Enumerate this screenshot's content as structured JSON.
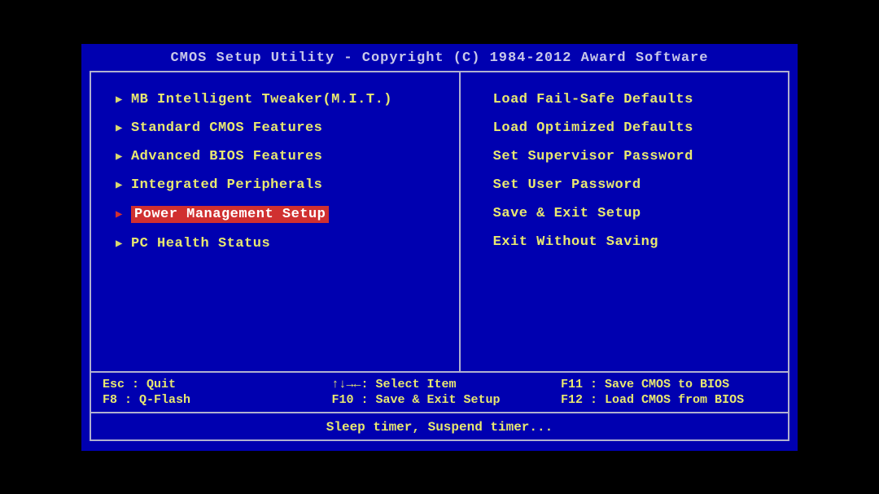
{
  "header": {
    "title": "CMOS Setup Utility - Copyright (C) 1984-2012 Award Software"
  },
  "left_menu": {
    "items": [
      {
        "label": "MB Intelligent Tweaker(M.I.T.)",
        "selected": false
      },
      {
        "label": "Standard CMOS Features",
        "selected": false
      },
      {
        "label": "Advanced BIOS Features",
        "selected": false
      },
      {
        "label": "Integrated Peripherals",
        "selected": false
      },
      {
        "label": "Power Management Setup",
        "selected": true
      },
      {
        "label": "PC Health Status",
        "selected": false
      }
    ]
  },
  "right_menu": {
    "items": [
      {
        "label": "Load Fail-Safe Defaults"
      },
      {
        "label": "Load Optimized Defaults"
      },
      {
        "label": "Set Supervisor Password"
      },
      {
        "label": "Set User Password"
      },
      {
        "label": "Save & Exit Setup"
      },
      {
        "label": "Exit Without Saving"
      }
    ]
  },
  "footer": {
    "left": {
      "row0": "Esc : Quit",
      "row1": "F8  : Q-Flash"
    },
    "mid": {
      "row0": "↑↓→←: Select Item",
      "row1": "F10 : Save & Exit Setup"
    },
    "right": {
      "row0": "F11 : Save CMOS to BIOS",
      "row1": "F12 : Load CMOS from BIOS"
    }
  },
  "help": {
    "text": "Sleep timer, Suspend timer..."
  }
}
